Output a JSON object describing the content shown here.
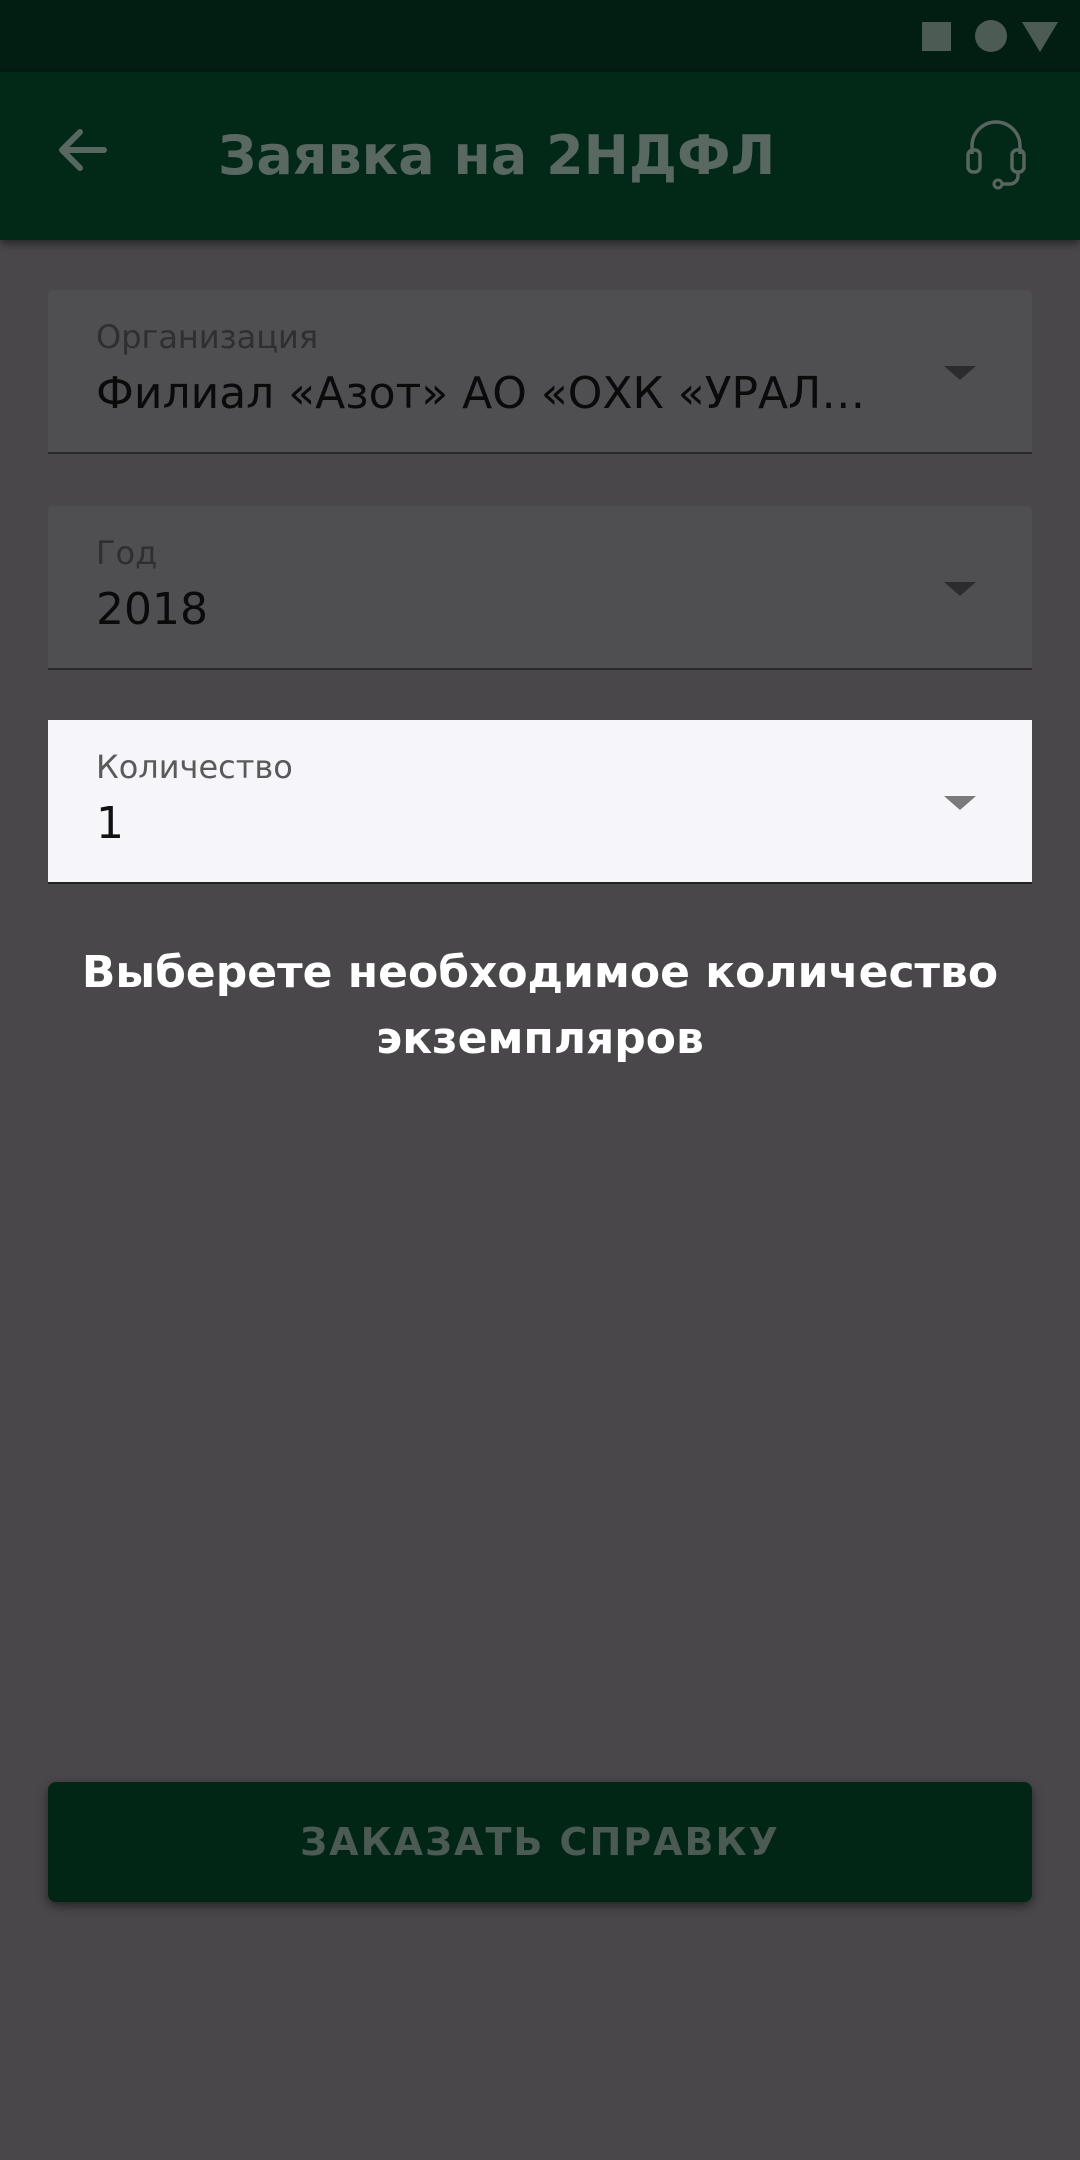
{
  "status_bar": {
    "icons": [
      "square-icon",
      "circle-icon",
      "triangle-icon"
    ]
  },
  "app_bar": {
    "title": "Заявка на 2НДФЛ",
    "back_icon": "arrow-left-icon",
    "support_icon": "headset-icon"
  },
  "form": {
    "organization": {
      "label": "Организация",
      "value": "Филиал «Азот» АО «ОХК «УРАЛ…"
    },
    "year": {
      "label": "Год",
      "value": "2018"
    },
    "quantity": {
      "label": "Количество",
      "value": "1"
    }
  },
  "hint": {
    "text": "Выберете необходимое количество экземпляров"
  },
  "order_button": {
    "label": "ЗАКАЗАТЬ СПРАВКУ"
  },
  "colors": {
    "status_bar": "#021d12",
    "app_bar": "#022817",
    "background": "#49474a",
    "active_field": "#f6f5f9",
    "button": "#022616"
  }
}
